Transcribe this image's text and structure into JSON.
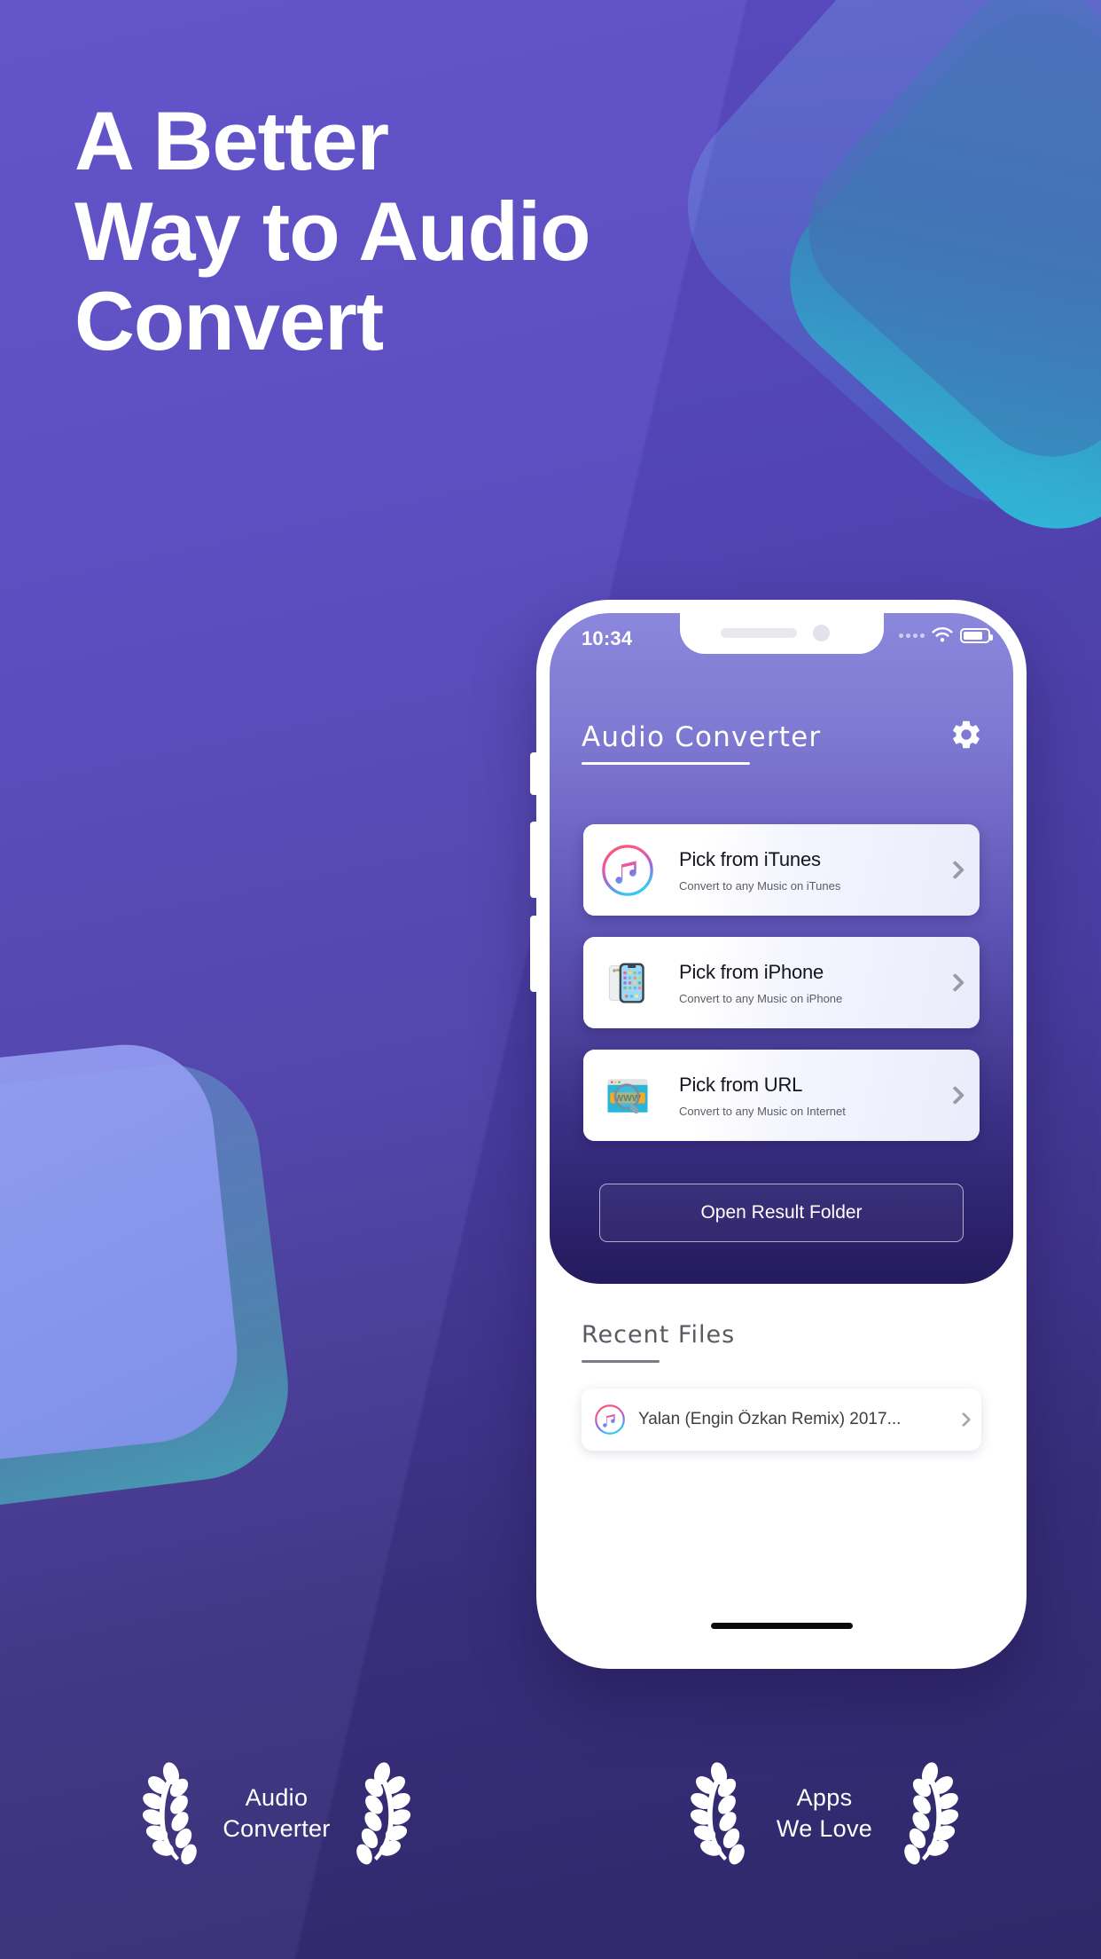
{
  "headline": {
    "line1": "A Better",
    "line2": "Way to Audio",
    "line3": "Convert"
  },
  "colors": {
    "bg_top": "#5e4ec8",
    "bg_bottom": "#322a6e",
    "accent_cyan": "#2fd0e8",
    "panel_top": "#8b87dc",
    "panel_bottom": "#241a5d",
    "text_on_dark": "#ffffff"
  },
  "phone": {
    "status": {
      "time": "10:34",
      "wifi_icon": "wifi-icon",
      "battery_icon": "battery-icon",
      "signal_icon": "signal-dots-icon"
    },
    "header": {
      "title": "Audio Converter",
      "settings_icon": "gear-icon"
    },
    "options": [
      {
        "icon": "itunes-icon",
        "title": "Pick from iTunes",
        "subtitle": "Convert to any Music on iTunes",
        "chevron_icon": "chevron-right-icon"
      },
      {
        "icon": "iphone-icon",
        "title": "Pick from iPhone",
        "subtitle": "Convert to any Music on iPhone",
        "chevron_icon": "chevron-right-icon"
      },
      {
        "icon": "url-browser-icon",
        "title": "Pick from URL",
        "subtitle": "Convert to any Music on Internet",
        "chevron_icon": "chevron-right-icon"
      }
    ],
    "open_folder_label": "Open Result Folder",
    "recent": {
      "heading": "Recent Files",
      "items": [
        {
          "icon": "itunes-icon",
          "name": "Yalan (Engin Özkan Remix) 2017...",
          "chevron_icon": "chevron-right-icon"
        }
      ]
    },
    "home_indicator": "home-indicator"
  },
  "awards": [
    {
      "laurel_icon": "laurel-icon",
      "line1": "Audio",
      "line2": "Converter"
    },
    {
      "laurel_icon": "laurel-icon",
      "line1": "Apps",
      "line2": "We Love"
    }
  ]
}
